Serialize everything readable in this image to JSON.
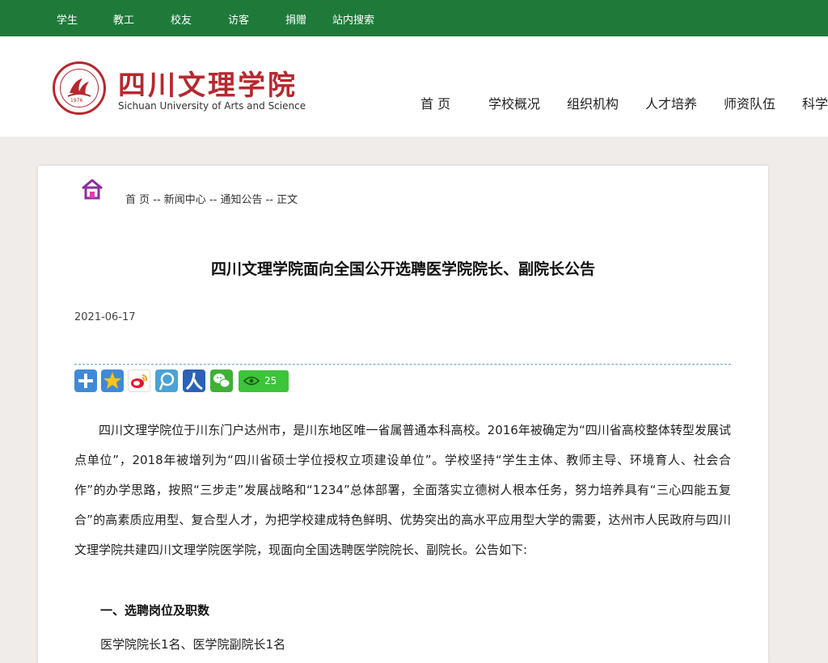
{
  "topbar": {
    "links": [
      "学生",
      "教工",
      "校友",
      "访客",
      "捐赠",
      "站内搜索"
    ]
  },
  "header": {
    "logo_cn": "四川文理学院",
    "logo_en": "Sichuan University of Arts and Science",
    "seal_year": "1976",
    "nav": [
      "首 页",
      "学校概况",
      "组织机构",
      "人才培养",
      "师资队伍",
      "科学"
    ]
  },
  "article": {
    "breadcrumb": [
      "首 页",
      "新闻中心",
      "通知公告",
      "正文"
    ],
    "breadcrumb_sep": " -- ",
    "title": "四川文理学院面向全国公开选聘医学院院长、副院长公告",
    "date": "2021-06-17",
    "share_count": "25",
    "paragraph": "四川文理学院位于川东门户达州市，是川东地区唯一省属普通本科高校。2016年被确定为“四川省高校整体转型发展试点单位”，2018年被增列为“四川省硕士学位授权立项建设单位”。学校坚持“学生主体、教师主导、环境育人、社会合作”的办学思路，按照“三步走”发展战略和“1234”总体部署，全面落实立德树人根本任务，努力培养具有“三心四能五复合”的高素质应用型、复合型人才，为把学校建成特色鲜明、优势突出的高水平应用型大学的需要，达州市人民政府与四川文理学院共建四川文理学院医学院，现面向全国选聘医学院院长、副院长。公告如下:",
    "section_heading": "一、选聘岗位及职数",
    "section_text": "医学院院长1名、医学院副院长1名"
  },
  "colors": {
    "topbar": "#1f7a3a",
    "brand_red": "#b7282e",
    "background": "#efecea",
    "share_green": "#3cc43a"
  },
  "icons": [
    "home-icon",
    "share-plus-icon",
    "qzone-icon",
    "weibo-icon",
    "tencent-weibo-icon",
    "renren-icon",
    "wechat-icon",
    "eye-icon"
  ]
}
